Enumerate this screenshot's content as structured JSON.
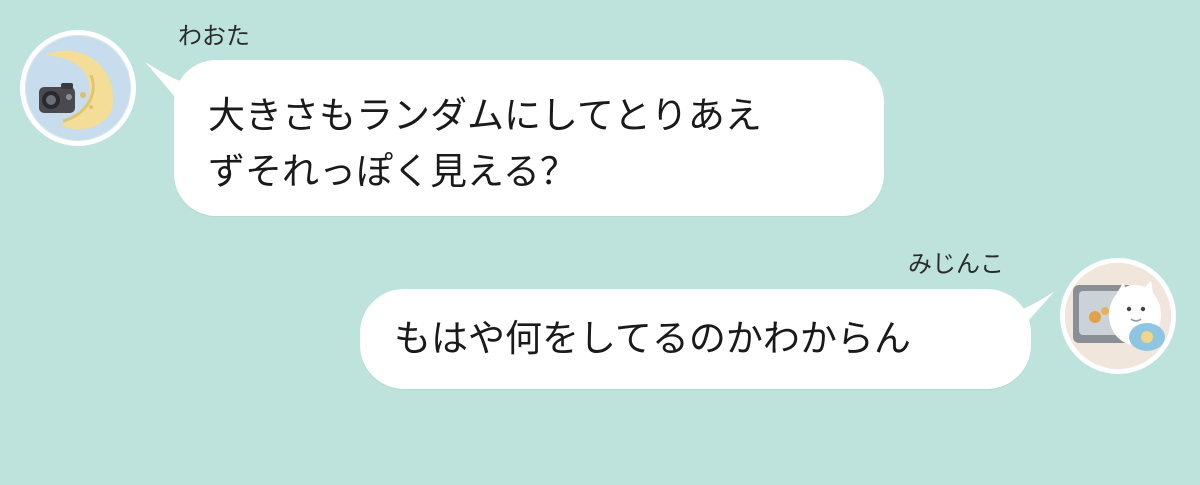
{
  "messages": [
    {
      "sender": "わおた",
      "direction": "incoming",
      "text": "大きさもランダムにしてとりあえ\nずそれっぽく見える？",
      "avatar_icon": "moon-camera-avatar-icon"
    },
    {
      "sender": "みじんこ",
      "direction": "outgoing",
      "text": "もはや何をしてるのかわからん",
      "avatar_icon": "cat-avatar-icon"
    }
  ],
  "colors": {
    "background": "#bde3dc",
    "bubble": "#ffffff",
    "text": "#1a1a1a",
    "sender_text": "#2b2b2b"
  }
}
